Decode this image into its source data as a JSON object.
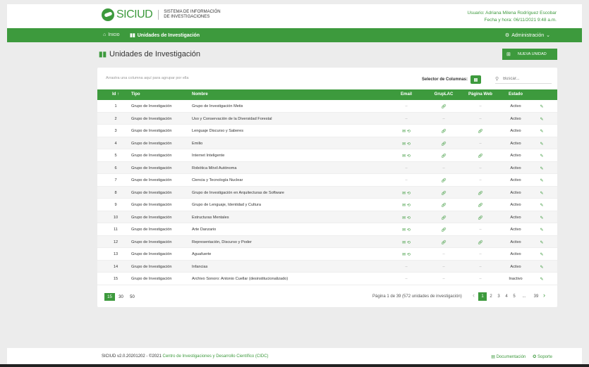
{
  "header": {
    "brand": "SICIUD",
    "brand_sub": "SISTEMA DE INFORMACIÓN DE INVESTIGACIONES",
    "user_line": "Usuario: Adriana Milena Rodríguez Escobar",
    "date_line": "Fecha y hora: 06/11/2021 9:48 a.m."
  },
  "nav": {
    "home": "Inicio",
    "units": "Unidades de Investigación",
    "admin": "Administración"
  },
  "page": {
    "title": "Unidades de Investigación",
    "new_button": "NUEVA UNIDAD"
  },
  "toolbar": {
    "group_hint": "Arrastra una columna aquí para agrupar por ella",
    "column_selector": "Selector de Columnas:",
    "search_placeholder": "Buscar..."
  },
  "table": {
    "headers": {
      "id": "Id",
      "tipo": "Tipo",
      "nombre": "Nombre",
      "email": "Email",
      "gruplac": "GrupLAC",
      "pagina": "Página Web",
      "estado": "Estado"
    },
    "rows": [
      {
        "id": "1",
        "tipo": "Grupo de Investigación",
        "nombre": "Grupo de Investigación Metis",
        "email": false,
        "gruplac": true,
        "web": false,
        "estado": "Activo"
      },
      {
        "id": "2",
        "tipo": "Grupo de Investigación",
        "nombre": "Uso y Conservación de la Diversidad Forestal",
        "email": false,
        "gruplac": false,
        "web": false,
        "estado": "Activo"
      },
      {
        "id": "3",
        "tipo": "Grupo de Investigación",
        "nombre": "Lenguaje Discurso y Saberes",
        "email": true,
        "gruplac": true,
        "web": true,
        "estado": "Activo"
      },
      {
        "id": "4",
        "tipo": "Grupo de Investigación",
        "nombre": "Emilio",
        "email": true,
        "gruplac": true,
        "web": false,
        "estado": "Activo"
      },
      {
        "id": "5",
        "tipo": "Grupo de Investigación",
        "nombre": "Internet Inteligente",
        "email": true,
        "gruplac": true,
        "web": true,
        "estado": "Activo"
      },
      {
        "id": "6",
        "tipo": "Grupo de Investigación",
        "nombre": "Robótica Mòvil Autónoma",
        "email": false,
        "gruplac": false,
        "web": false,
        "estado": "Activo"
      },
      {
        "id": "7",
        "tipo": "Grupo de Investigación",
        "nombre": "Ciencia y Tecnología Nuclear",
        "email": false,
        "gruplac": true,
        "web": false,
        "estado": "Activo"
      },
      {
        "id": "8",
        "tipo": "Grupo de Investigación",
        "nombre": "Grupo de Investigación en Arquitecturas de Software",
        "email": true,
        "gruplac": true,
        "web": true,
        "estado": "Activo"
      },
      {
        "id": "9",
        "tipo": "Grupo de Investigación",
        "nombre": "Grupo de Lenguaje, Identidad y Cultura",
        "email": true,
        "gruplac": true,
        "web": true,
        "estado": "Activo"
      },
      {
        "id": "10",
        "tipo": "Grupo de Investigación",
        "nombre": "Estructuras Mentales",
        "email": true,
        "gruplac": true,
        "web": true,
        "estado": "Activo"
      },
      {
        "id": "11",
        "tipo": "Grupo de Investigación",
        "nombre": "Arte Danzario",
        "email": true,
        "gruplac": true,
        "web": false,
        "estado": "Activo"
      },
      {
        "id": "12",
        "tipo": "Grupo de Investigación",
        "nombre": "Representación, Discurso y Poder",
        "email": true,
        "gruplac": true,
        "web": true,
        "estado": "Activo"
      },
      {
        "id": "13",
        "tipo": "Grupo de Investigación",
        "nombre": "Aguafuerte",
        "email": true,
        "gruplac": false,
        "web": false,
        "estado": "Activo"
      },
      {
        "id": "14",
        "tipo": "Grupo de Investigación",
        "nombre": "Infancias",
        "email": false,
        "gruplac": false,
        "web": false,
        "estado": "Activo"
      },
      {
        "id": "15",
        "tipo": "Grupo de Investigación",
        "nombre": "Archivo Sonoro: Antonio Cuellar (desinstitucionalizado)",
        "email": false,
        "gruplac": false,
        "web": false,
        "estado": "Inactivo"
      }
    ]
  },
  "pager": {
    "sizes": [
      "15",
      "30",
      "50"
    ],
    "active_size": "15",
    "info": "Página 1 de 39 (572 unidades de investigación)",
    "pages": [
      "1",
      "2",
      "3",
      "4",
      "5",
      "...",
      "39"
    ],
    "active_page": "1"
  },
  "footer": {
    "version": "SICIUD v2.0.20201202 - ©2021",
    "org_link": "Centro de Investigaciones y Desarrollo Científico (CIDC)",
    "docs": "Documentación",
    "support": "Soporte"
  },
  "colors": {
    "primary": "#3d9a3d"
  }
}
